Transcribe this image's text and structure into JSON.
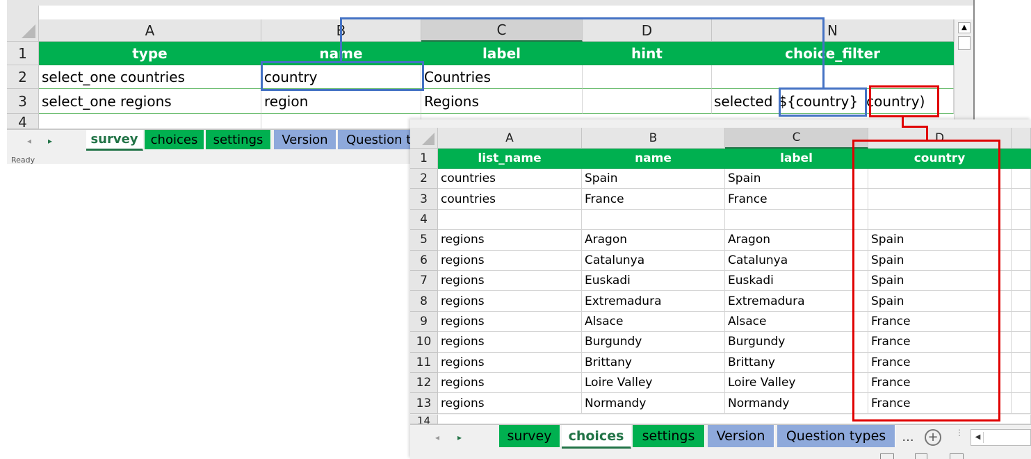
{
  "survey_sheet": {
    "columns": [
      "A",
      "B",
      "C",
      "D",
      "N"
    ],
    "rows": [
      "1",
      "2",
      "3",
      "4"
    ],
    "header": [
      "type",
      "name",
      "label",
      "hint",
      "choice_filter"
    ],
    "data": [
      [
        "select_one countries",
        "country",
        "Countries",
        "",
        ""
      ],
      [
        "select_one regions",
        "region",
        "Regions",
        "",
        "selected ${country} country)"
      ]
    ],
    "choice_filter_parts": [
      "selected",
      "${country}",
      "country)"
    ],
    "tabs": [
      "survey",
      "choices",
      "settings",
      "Version",
      "Question ty"
    ],
    "status": "Ready"
  },
  "choices_sheet": {
    "columns": [
      "A",
      "B",
      "C",
      "D"
    ],
    "header": [
      "list_name",
      "name",
      "label",
      "country"
    ],
    "rows": [
      {
        "n": "2",
        "cells": [
          "countries",
          "Spain",
          "Spain",
          ""
        ]
      },
      {
        "n": "3",
        "cells": [
          "countries",
          "France",
          "France",
          ""
        ]
      },
      {
        "n": "4",
        "cells": [
          "",
          "",
          "",
          ""
        ]
      },
      {
        "n": "5",
        "cells": [
          "regions",
          "Aragon",
          "Aragon",
          "Spain"
        ]
      },
      {
        "n": "6",
        "cells": [
          "regions",
          "Catalunya",
          "Catalunya",
          "Spain"
        ]
      },
      {
        "n": "7",
        "cells": [
          "regions",
          "Euskadi",
          "Euskadi",
          "Spain"
        ]
      },
      {
        "n": "8",
        "cells": [
          "regions",
          "Extremadura",
          "Extremadura",
          "Spain"
        ]
      },
      {
        "n": "9",
        "cells": [
          "regions",
          "Alsace",
          "Alsace",
          "France"
        ]
      },
      {
        "n": "10",
        "cells": [
          "regions",
          "Burgundy",
          "Burgundy",
          "France"
        ]
      },
      {
        "n": "11",
        "cells": [
          "regions",
          "Brittany",
          "Brittany",
          "France"
        ]
      },
      {
        "n": "12",
        "cells": [
          "regions",
          "Loire Valley",
          "Loire Valley",
          "France"
        ]
      },
      {
        "n": "13",
        "cells": [
          "regions",
          "Normandy",
          "Normandy",
          "France"
        ]
      }
    ],
    "row1": "1",
    "row14": "14",
    "tabs": [
      "survey",
      "choices",
      "settings",
      "Version",
      "Question types"
    ],
    "more": "..."
  },
  "colors": {
    "header_green": "#00b050",
    "tab_blue": "#8ea9db",
    "callout_blue": "#4472c4",
    "callout_red": "#e00000"
  }
}
